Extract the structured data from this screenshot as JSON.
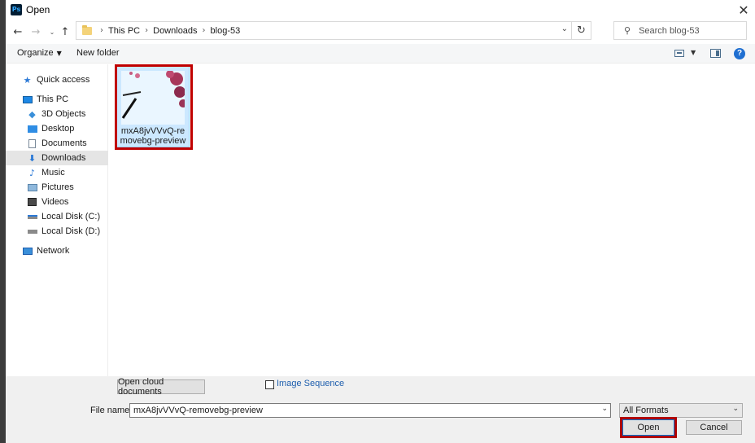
{
  "window": {
    "title": "Open",
    "app_icon": "Ps"
  },
  "address_bar": {
    "breadcrumbs": [
      "This PC",
      "Downloads",
      "blog-53"
    ]
  },
  "search": {
    "placeholder": "Search blog-53"
  },
  "toolbar": {
    "organize_label": "Organize",
    "new_folder_label": "New folder"
  },
  "sidebar": {
    "items": [
      {
        "label": "Quick access",
        "icon": "star-icon"
      },
      {
        "label": "This PC",
        "icon": "computer-icon"
      },
      {
        "label": "3D Objects",
        "icon": "cube-icon"
      },
      {
        "label": "Desktop",
        "icon": "desktop-icon"
      },
      {
        "label": "Documents",
        "icon": "document-icon"
      },
      {
        "label": "Downloads",
        "icon": "download-icon",
        "selected": true
      },
      {
        "label": "Music",
        "icon": "music-icon"
      },
      {
        "label": "Pictures",
        "icon": "picture-icon"
      },
      {
        "label": "Videos",
        "icon": "video-icon"
      },
      {
        "label": "Local Disk (C:)",
        "icon": "drive-icon"
      },
      {
        "label": "Local Disk (D:)",
        "icon": "drive-icon"
      },
      {
        "label": "Network",
        "icon": "network-icon"
      }
    ]
  },
  "files": [
    {
      "name": "mxA8jvVVvQ-removebg-preview",
      "name_line1": "mxA8jvVVvQ-re",
      "name_line2": "movebg-preview",
      "selected": true
    }
  ],
  "bottom": {
    "cloud_button_label": "Open cloud documents",
    "image_sequence_label": "Image Sequence",
    "file_name_label": "File name:",
    "file_name_value": "mxA8jvVVvQ-removebg-preview",
    "format_value": "All Formats",
    "open_label": "Open",
    "cancel_label": "Cancel"
  },
  "colors": {
    "highlight_red": "#c00000",
    "selection_blue": "#cce8ff",
    "help_blue": "#1f6fd1"
  }
}
